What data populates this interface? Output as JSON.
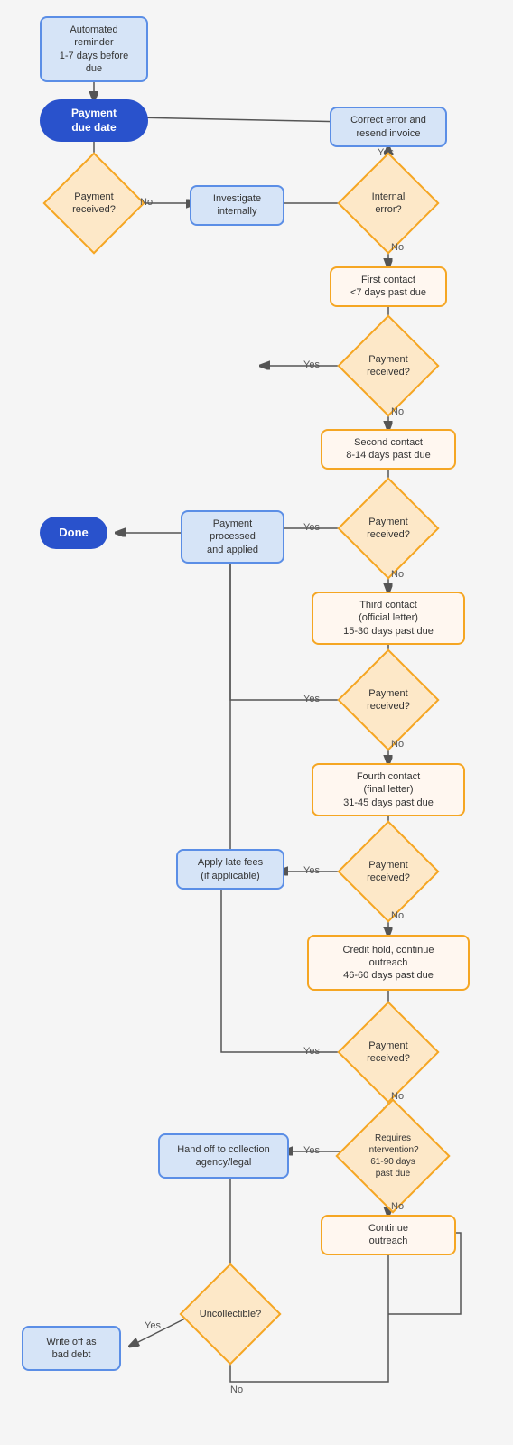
{
  "nodes": {
    "automated_reminder": {
      "label": "Automated reminder\n1-7 days before due",
      "type": "rounded_blue_outline"
    },
    "payment_due_date": {
      "label": "Payment\ndue date",
      "type": "pill_blue_filled"
    },
    "payment_received_1": {
      "label": "Payment\nreceived?",
      "type": "diamond_orange"
    },
    "investigate_internally": {
      "label": "Investigate\ninternally",
      "type": "rounded_blue_light"
    },
    "internal_error": {
      "label": "Internal\nerror?",
      "type": "diamond_orange"
    },
    "correct_error": {
      "label": "Correct error and\nresend invoice",
      "type": "rounded_blue_light"
    },
    "first_contact": {
      "label": "First contact\n<7 days past due",
      "type": "rounded_orange_outline"
    },
    "payment_received_2": {
      "label": "Payment\nreceived?",
      "type": "diamond_orange"
    },
    "second_contact": {
      "label": "Second contact\n8-14 days past due",
      "type": "rounded_orange_outline"
    },
    "payment_received_3": {
      "label": "Payment\nreceived?",
      "type": "diamond_orange"
    },
    "payment_processed": {
      "label": "Payment processed\nand applied",
      "type": "rounded_blue_light"
    },
    "done": {
      "label": "Done",
      "type": "pill_blue_filled"
    },
    "third_contact": {
      "label": "Third contact\n(official letter)\n15-30 days past due",
      "type": "rounded_orange_outline"
    },
    "payment_received_4": {
      "label": "Payment\nreceived?",
      "type": "diamond_orange"
    },
    "fourth_contact": {
      "label": "Fourth contact\n(final letter)\n31-45 days past due",
      "type": "rounded_orange_outline"
    },
    "payment_received_5": {
      "label": "Payment\nreceived?",
      "type": "diamond_orange"
    },
    "apply_late_fees": {
      "label": "Apply late fees\n(if applicable)",
      "type": "rounded_blue_light"
    },
    "credit_hold": {
      "label": "Credit hold, continue\noutreach\n46-60 days past due",
      "type": "rounded_orange_outline"
    },
    "payment_received_6": {
      "label": "Payment\nreceived?",
      "type": "diamond_orange"
    },
    "requires_intervention": {
      "label": "Requires\nintervention?\n61-90 days past\ndue",
      "type": "diamond_orange"
    },
    "hand_off": {
      "label": "Hand off to collection\nagency/legal",
      "type": "rounded_blue_light"
    },
    "continue_outreach": {
      "label": "Continue\noutreach",
      "type": "rounded_orange_outline"
    },
    "uncollectible": {
      "label": "Uncollectible?",
      "type": "diamond_orange"
    },
    "write_off": {
      "label": "Write off as\nbad debt",
      "type": "rounded_blue_light"
    }
  },
  "labels": {
    "no": "No",
    "yes": "Yes"
  }
}
